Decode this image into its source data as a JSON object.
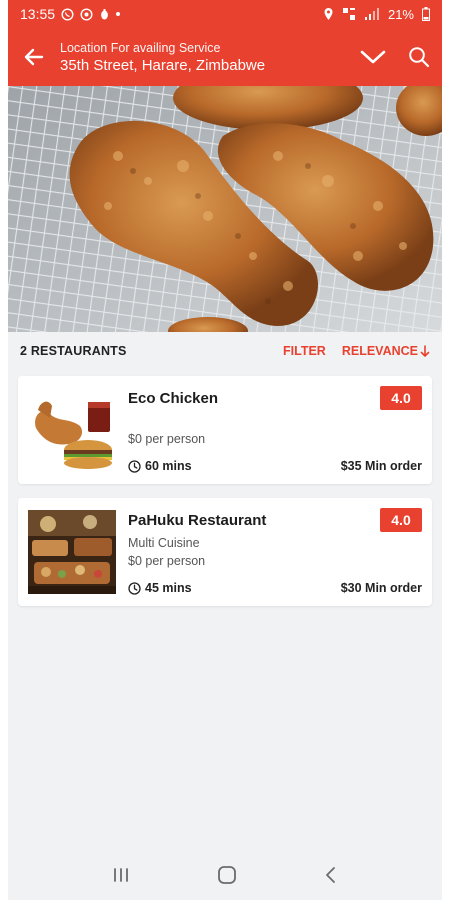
{
  "status_bar": {
    "time": "13:55",
    "battery": "21%"
  },
  "app_bar": {
    "location_label": "Location For availing Service",
    "address": "35th Street, Harare, Zimbabwe"
  },
  "list_header": {
    "count_label": "2 RESTAURANTS",
    "filter_label": "FILTER",
    "sort_label": "RELEVANCE"
  },
  "restaurants": [
    {
      "name": "Eco Chicken",
      "cuisine": "",
      "price": "$0 per person",
      "delivery_time": "60 mins",
      "min_order": "$35 Min order",
      "rating": "4.0"
    },
    {
      "name": "PaHuku Restaurant",
      "cuisine": "Multi Cuisine",
      "price": "$0 per person",
      "delivery_time": "45 mins",
      "min_order": "$30 Min order",
      "rating": "4.0"
    }
  ],
  "colors": {
    "accent": "#e8412f",
    "background": "#f1f2f4"
  }
}
